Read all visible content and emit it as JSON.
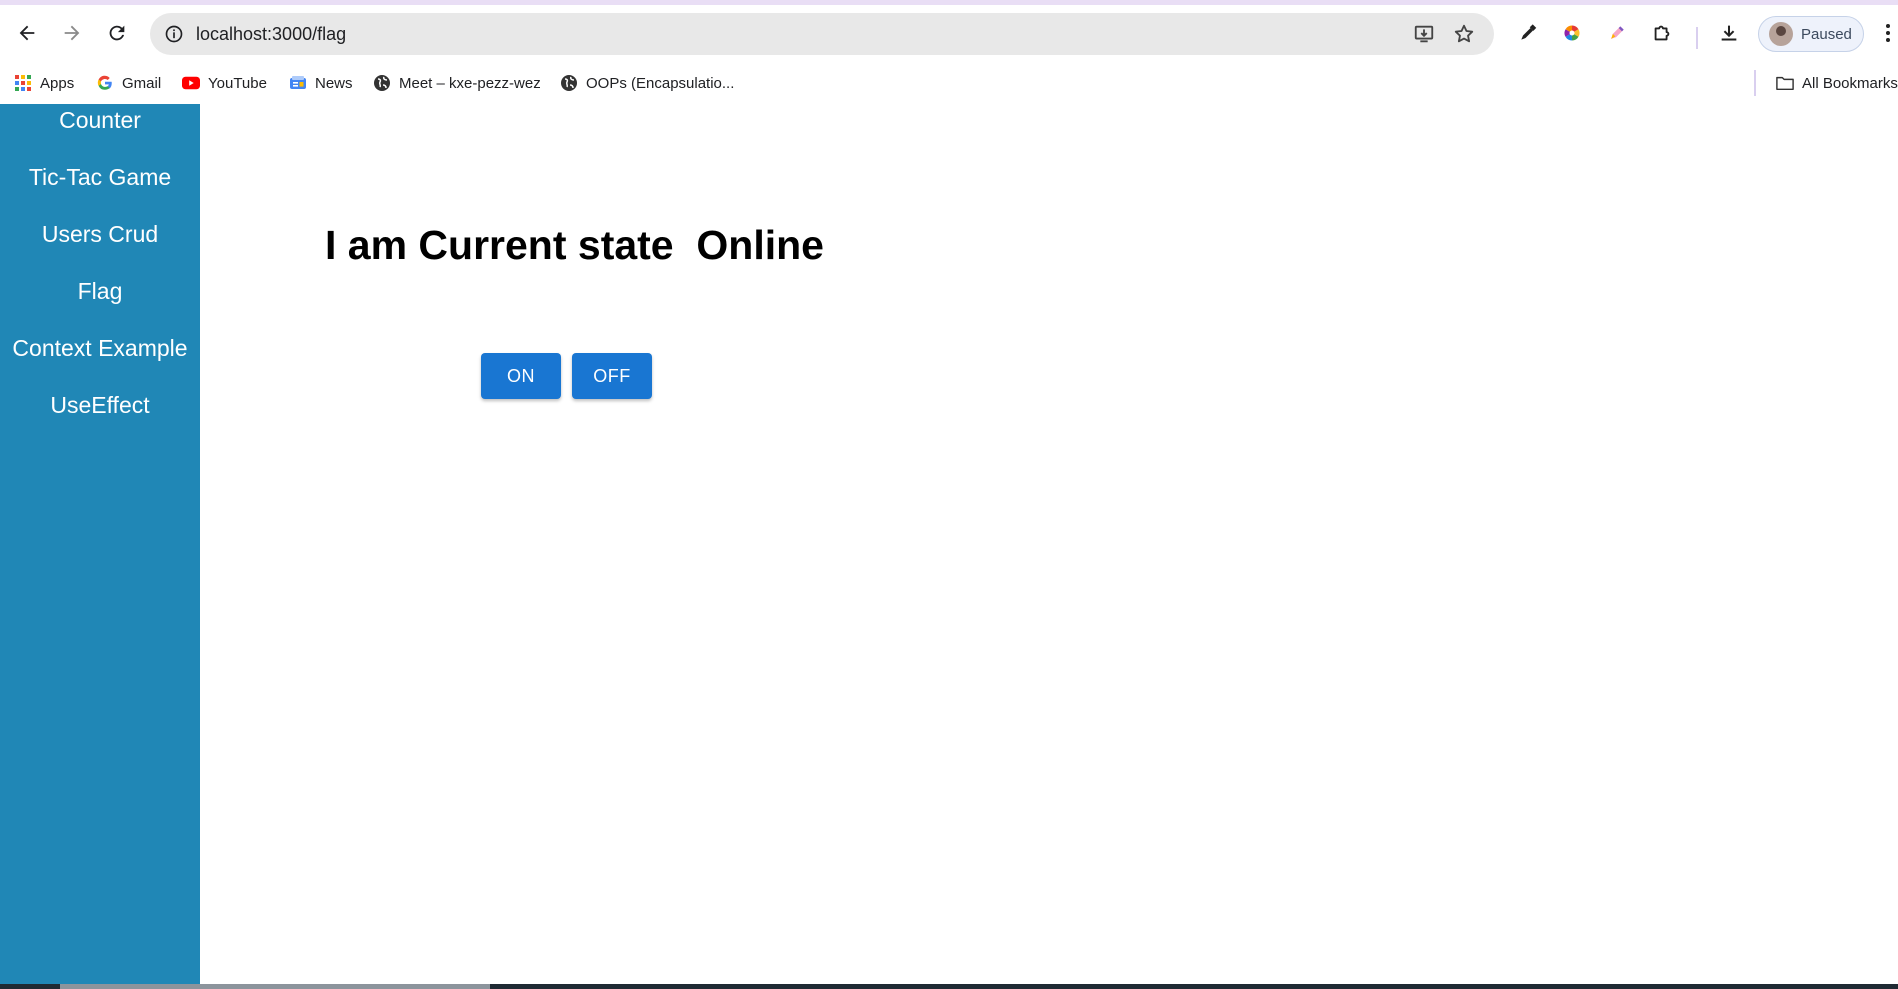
{
  "browser": {
    "url": "localhost:3000/flag",
    "profile_label": "Paused",
    "icons": [
      "back-arrow-icon",
      "forward-arrow-icon",
      "reload-icon",
      "info-icon",
      "install-app-icon",
      "star-icon",
      "eyedropper-icon",
      "color-wheel-icon",
      "pencil-icon",
      "puzzle-icon",
      "download-icon",
      "kebab-menu-icon"
    ]
  },
  "bookmarks": {
    "items": [
      {
        "label": "Apps",
        "icon": "apps-grid-icon"
      },
      {
        "label": "Gmail",
        "icon": "google-g-icon"
      },
      {
        "label": "YouTube",
        "icon": "youtube-icon"
      },
      {
        "label": "News",
        "icon": "news-icon"
      },
      {
        "label": "Meet – kxe-pezz-wez",
        "icon": "globe-icon"
      },
      {
        "label": "OOPs (Encapsulatio...",
        "icon": "globe-icon"
      }
    ],
    "all_label": "All Bookmarks"
  },
  "sidebar": {
    "items": [
      {
        "label": "Counter"
      },
      {
        "label": "Tic-Tac Game"
      },
      {
        "label": "Users Crud"
      },
      {
        "label": "Flag"
      },
      {
        "label": "Context Example"
      },
      {
        "label": "UseEffect"
      }
    ]
  },
  "main": {
    "heading": "I am Current state  Online",
    "on_label": "ON",
    "off_label": "OFF"
  },
  "colors": {
    "sidebar": "#2087b6",
    "button": "#1976d2"
  }
}
